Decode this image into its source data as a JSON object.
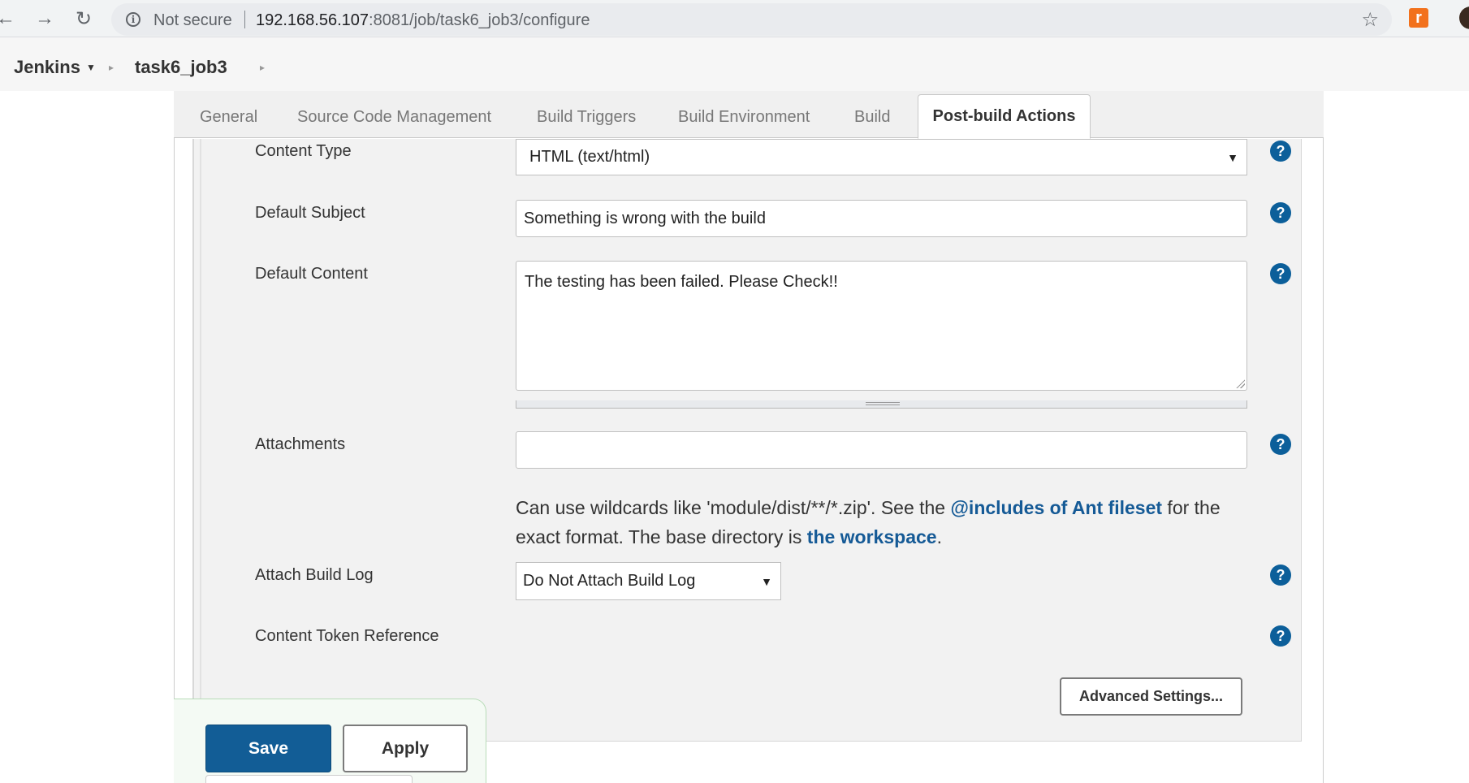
{
  "browser": {
    "not_secure": "Not secure",
    "url_host": "192.168.56.107",
    "url_rest": ":8081/job/task6_job3/configure"
  },
  "breadcrumb": {
    "root": "Jenkins",
    "job": "task6_job3"
  },
  "tabs": [
    "General",
    "Source Code Management",
    "Build Triggers",
    "Build Environment",
    "Build",
    "Post-build Actions"
  ],
  "form": {
    "content_type_label": "Content Type",
    "content_type_value": "HTML (text/html)",
    "default_subject_label": "Default Subject",
    "default_subject_value": "Something is wrong with the build",
    "default_content_label": "Default Content",
    "default_content_value": "The testing has been failed. Please Check!!",
    "attachments_label": "Attachments",
    "attachments_value": "",
    "attachments_help_1": "Can use wildcards like 'module/dist/**/*.zip'. See the ",
    "attachments_help_link_1": "@includes of Ant fileset",
    "attachments_help_2": " for the exact format. The base directory is ",
    "attachments_help_link_2": "the workspace",
    "attachments_help_3": ".",
    "attach_build_log_label": "Attach Build Log",
    "attach_build_log_value": "Do Not Attach Build Log",
    "content_token_label": "Content Token Reference",
    "help_glyph": "?",
    "advanced_button": "Advanced Settings..."
  },
  "actions": {
    "save": "Save",
    "apply": "Apply"
  },
  "colors": {
    "primary": "#125d96",
    "help": "#0c5f9a",
    "link": "#155a96"
  }
}
